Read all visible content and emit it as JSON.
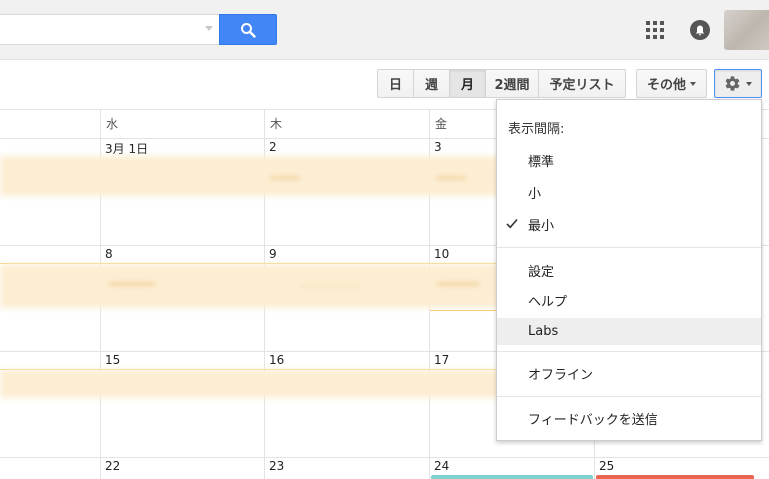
{
  "search": {
    "placeholder": ""
  },
  "toolbar": {
    "views": [
      {
        "label": "日",
        "active": false
      },
      {
        "label": "週",
        "active": false
      },
      {
        "label": "月",
        "active": true
      },
      {
        "label": "2週間",
        "active": false
      },
      {
        "label": "予定リスト",
        "active": false
      }
    ],
    "more_label": "その他"
  },
  "calendar": {
    "weekdays": [
      "水",
      "木",
      "金"
    ],
    "weeks": [
      [
        "3月 1日",
        "2",
        "3"
      ],
      [
        "8",
        "9",
        "10"
      ],
      [
        "15",
        "16",
        "17"
      ],
      [
        "22",
        "23",
        "24",
        "25"
      ]
    ]
  },
  "settings_menu": {
    "heading": "表示間隔:",
    "density_items": [
      "標準",
      "小",
      "最小"
    ],
    "checked_item": "最小",
    "items": [
      "設定",
      "ヘルプ",
      "Labs"
    ],
    "highlighted_item": "Labs",
    "offline_label": "オフライン",
    "feedback_label": "フィードバックを送信"
  },
  "colors": {
    "accent": "#4285f4",
    "event_yellow": "#fdeed3",
    "event_teal": "#7fd3cf",
    "event_red": "#e8664f"
  },
  "icons": [
    "search-icon",
    "apps-grid-icon",
    "notifications-icon",
    "gear-icon",
    "checkmark-icon",
    "chevron-down-icon"
  ]
}
